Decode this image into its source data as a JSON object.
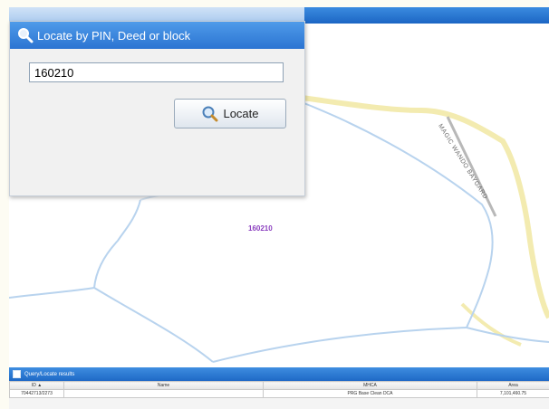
{
  "dialog": {
    "title": "Locate by PIN, Deed or block",
    "pin_value": "160210",
    "locate_label": "Locate",
    "icon": "search-icon"
  },
  "map": {
    "road_label": "MAGIC WANDO BAYGARD",
    "parcel_label": "160210",
    "colors": {
      "parcel_line": "#b8d3ee",
      "road": "#f3ebb0",
      "road_edge": "#cbbf6a"
    }
  },
  "results": {
    "title": "Query/Locate results",
    "columns": [
      "ID ▲",
      "Name",
      "MHCA",
      "Area"
    ],
    "rows": [
      [
        "70442713/2273",
        "",
        "PRG Base Clean DCA",
        "7,101,460.75"
      ]
    ]
  }
}
